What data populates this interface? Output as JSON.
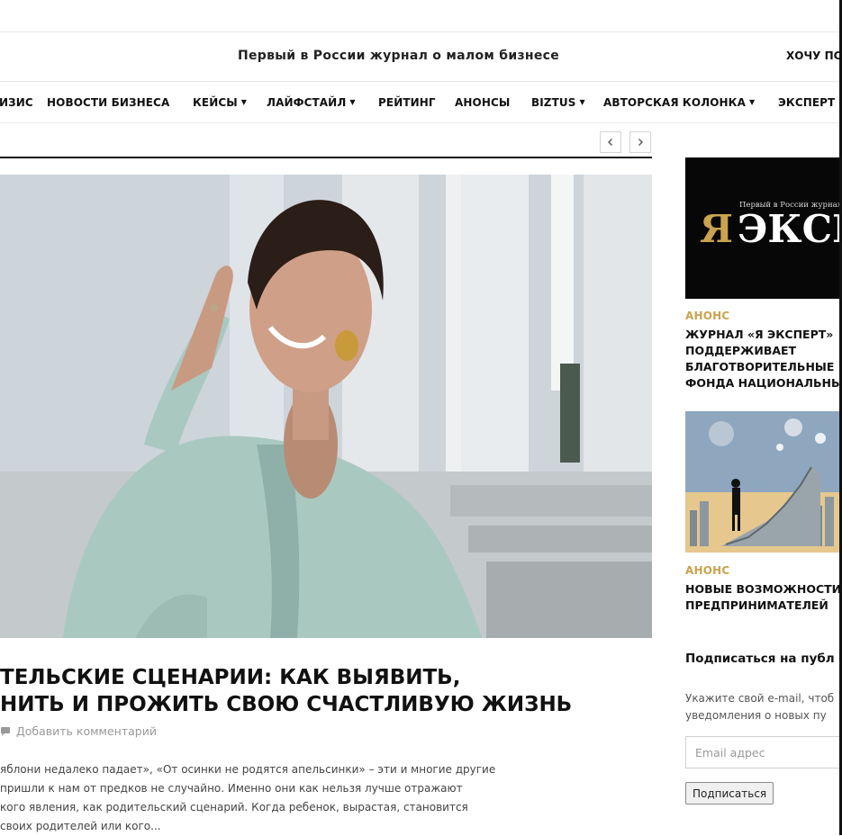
{
  "header": {
    "tagline": "Первый в России журнал о малом бизнесе",
    "cta": "ХОЧУ ПС"
  },
  "nav": {
    "items": [
      {
        "label": "ИЗИС",
        "dropdown": false
      },
      {
        "label": "НОВОСТИ БИЗНЕСА",
        "dropdown": false
      },
      {
        "label": "КЕЙСЫ",
        "dropdown": true
      },
      {
        "label": "ЛАЙФСТАЙЛ",
        "dropdown": true
      },
      {
        "label": "РЕЙТИНГ",
        "dropdown": false
      },
      {
        "label": "АНОНСЫ",
        "dropdown": false
      },
      {
        "label": "BIZTUS",
        "dropdown": true
      },
      {
        "label": "АВТОРСКАЯ КОЛОНКА",
        "dropdown": true
      },
      {
        "label": "ЭКСПЕРТ",
        "dropdown": false
      }
    ]
  },
  "article": {
    "title_line1": "ТЕЛЬСКИЕ СЦЕНАРИИ: КАК ВЫЯВИТЬ,",
    "title_line2": "НИТЬ И ПРОЖИТЬ СВОЮ СЧАСТЛИВУЮ ЖИЗНЬ",
    "comment_link": "Добавить комментарий",
    "excerpt": [
      "яблони недалеко падает», «От осинки не родятся апельсинки» – эти и многие другие",
      " пришли к нам от предков не случайно. Именно они как нельзя лучше отражают",
      "кого явления, как родительский сценарий. Когда ребенок, вырастая, становится",
      " своих родителей или кого..."
    ]
  },
  "sidebar": {
    "promo1": {
      "logo_small": "Первый в России журнал",
      "logo_ya": "Я",
      "logo_text": "ЭКСП",
      "tag": "АНОНС",
      "title_lines": [
        "ЖУРНАЛ «Я ЭКСПЕРТ»",
        "ПОДДЕРЖИВАЕТ",
        "БЛАГОТВОРИТЕЛЬНЫЕ",
        "ФОНДА НАЦИОНАЛЬНЫ"
      ]
    },
    "promo2": {
      "tag": "АНОНС",
      "title_lines": [
        "НОВЫЕ ВОЗМОЖНОСТИ",
        "ПРЕДПРИНИМАТЕЛЕЙ"
      ]
    },
    "subscribe": {
      "heading": "Подписаться на публ",
      "text_lines": [
        "Укажите свой e-mail, чтоб",
        "уведомления о новых пу"
      ],
      "email_placeholder": "Email адрес",
      "button_label": "Подписаться"
    }
  },
  "colors": {
    "accent_gold": "#c9a34e",
    "text": "#111111"
  }
}
